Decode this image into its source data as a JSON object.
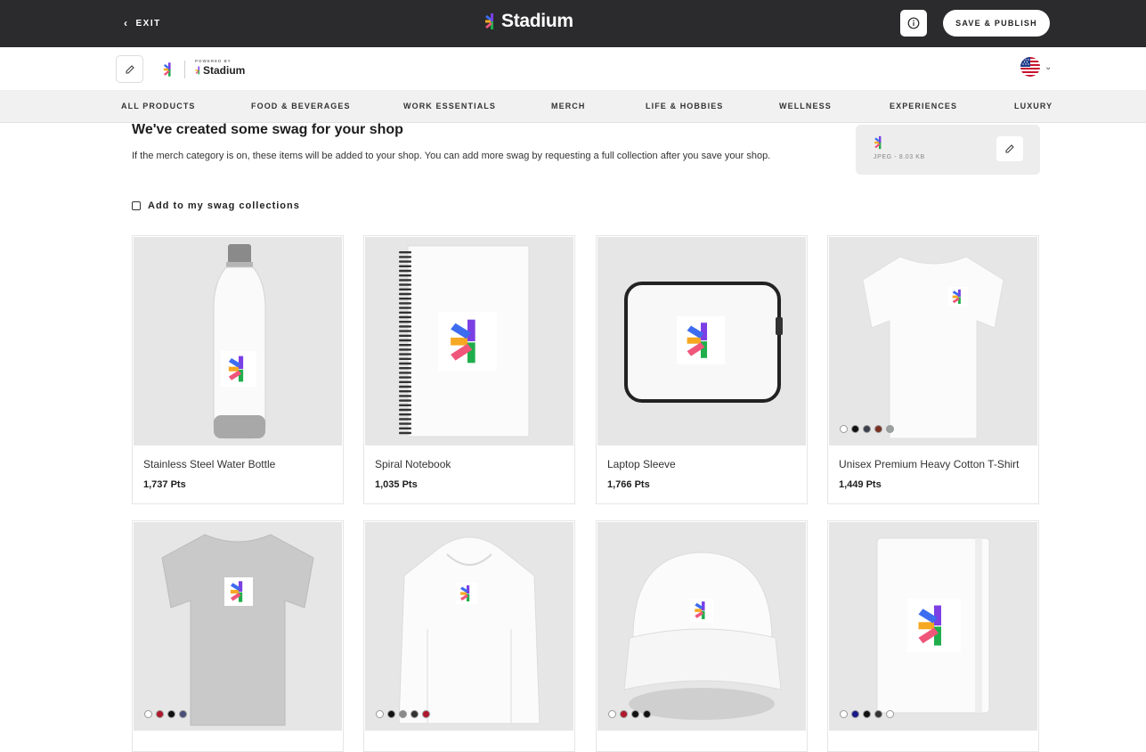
{
  "topbar": {
    "exit_label": "EXIT",
    "brand_name": "Stadium",
    "save_label": "SAVE & PUBLISH"
  },
  "shopbar": {
    "powered_by": "POWERED BY",
    "powered_name": "Stadium"
  },
  "categories": [
    "ALL PRODUCTS",
    "FOOD & BEVERAGES",
    "WORK ESSENTIALS",
    "MERCH",
    "LIFE & HOBBIES",
    "WELLNESS",
    "EXPERIENCES",
    "LUXURY"
  ],
  "intro": {
    "title": "We've created some swag for your shop",
    "text": "If the merch category is on, these items will be added to your shop. You can add more swag by requesting a full collection after you save your shop.",
    "logo_meta": "JPEG - 8.03 KB",
    "checkbox_label": "Add to my swag collections"
  },
  "products": [
    {
      "name": "Stainless Steel Water Bottle",
      "points": "1,737 Pts",
      "swatches": []
    },
    {
      "name": "Spiral Notebook",
      "points": "1,035 Pts",
      "swatches": []
    },
    {
      "name": "Laptop Sleeve",
      "points": "1,766 Pts",
      "swatches": []
    },
    {
      "name": "Unisex Premium Heavy Cotton T-Shirt",
      "points": "1,449 Pts",
      "swatches": [
        "#ffffff",
        "#111111",
        "#3a3f4a",
        "#7a2f22",
        "#9aa09e"
      ]
    },
    {
      "name": "",
      "points": "",
      "swatches": [
        "#ffffff",
        "#b0182d",
        "#111111",
        "#4a4f7a"
      ]
    },
    {
      "name": "",
      "points": "",
      "swatches": [
        "#ffffff",
        "#111111",
        "#8a8a8a",
        "#333333",
        "#b0182d"
      ]
    },
    {
      "name": "",
      "points": "",
      "swatches": [
        "#ffffff",
        "#b0182d",
        "#111111",
        "#111111"
      ]
    },
    {
      "name": "",
      "points": "",
      "swatches": [
        "#ffffff",
        "#1a1a8a",
        "#111111",
        "#333333",
        "#ffffff"
      ]
    }
  ],
  "colors": {
    "topbar": "#2b2b2d",
    "logo_purple": "#7b3fe4",
    "logo_blue": "#3d6cf0",
    "logo_orange": "#f7a823",
    "logo_pink": "#f0567a",
    "logo_green": "#1fae4b"
  }
}
